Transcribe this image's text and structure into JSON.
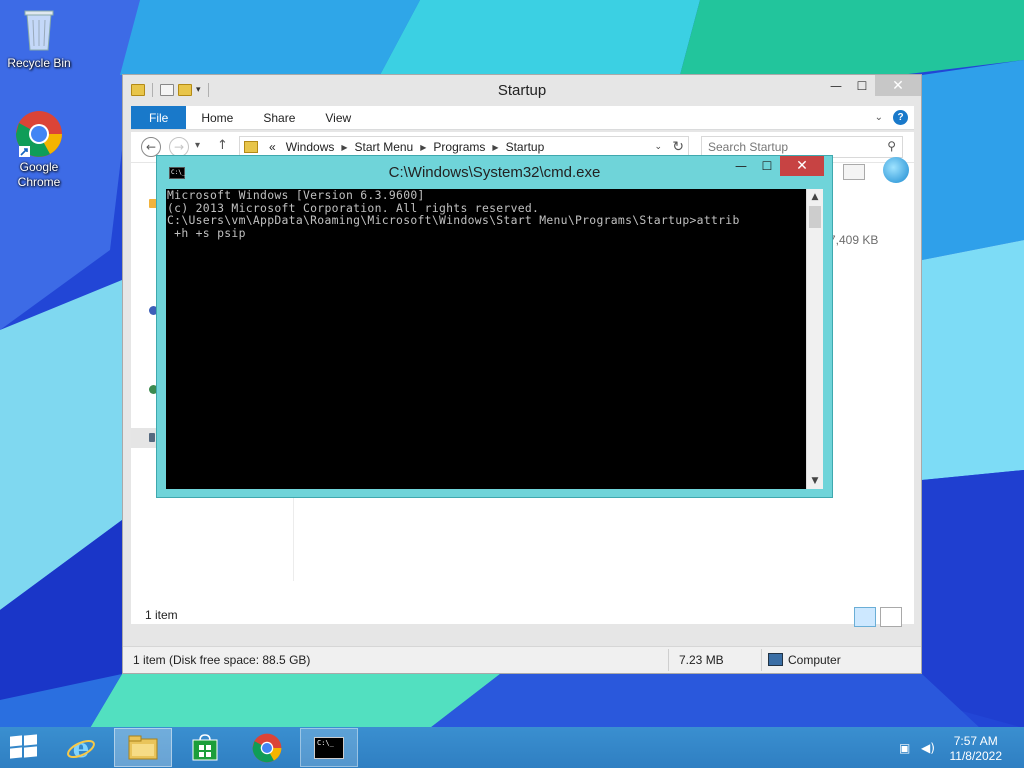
{
  "desktop": {
    "icons": [
      {
        "label": "Recycle Bin",
        "icon": "recycle-bin-icon"
      },
      {
        "label": "Google Chrome",
        "icon": "chrome-icon"
      }
    ]
  },
  "explorer": {
    "title": "Startup",
    "ribbon_tabs": [
      "File",
      "Home",
      "Share",
      "View"
    ],
    "breadcrumb": [
      "«",
      "Windows",
      "Start Menu",
      "Programs",
      "Startup"
    ],
    "search_placeholder": "Search Startup",
    "partial_size_text": "7,409 KB",
    "item_count": "1 item",
    "status": {
      "left": "1 item (Disk free space: 88.5 GB)",
      "size": "7.23 MB",
      "location": "Computer"
    },
    "colors": {
      "file_tab": "#1979ca"
    }
  },
  "cmd": {
    "title": "C:\\Windows\\System32\\cmd.exe",
    "icon_text": "C:\\_",
    "lines": [
      "Microsoft Windows [Version 6.3.9600]",
      "(c) 2013 Microsoft Corporation. All rights reserved.",
      "C:\\Users\\vm\\AppData\\Roaming\\Microsoft\\Windows\\Start Menu\\Programs\\Startup>attrib",
      " +h +s psip"
    ],
    "colors": {
      "frame": "#6fd4d9",
      "close": "#c74343",
      "console_bg": "#000000",
      "console_fg": "#c0c0c0"
    }
  },
  "taskbar": {
    "items": [
      "start-button",
      "internet-explorer",
      "file-explorer",
      "store",
      "chrome",
      "command-prompt"
    ],
    "time": "7:57 AM",
    "date": "11/8/2022"
  }
}
